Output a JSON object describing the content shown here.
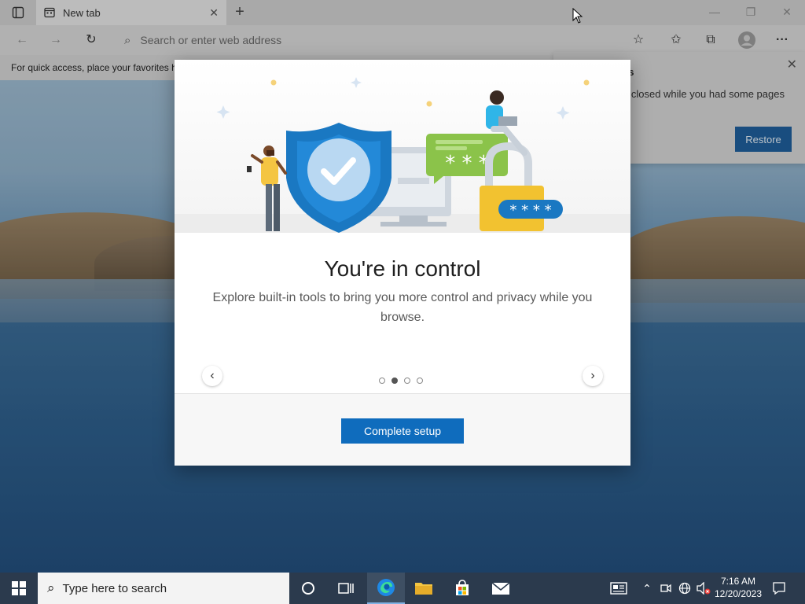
{
  "browser": {
    "tab_title": "New tab",
    "address_placeholder": "Search or enter web address",
    "favorites_bar_text": "For quick access, place your favorites h"
  },
  "restore_notification": {
    "title_fragment": "es",
    "body_fragment": "e closed while you had some pages",
    "restore_label": "Restore"
  },
  "modal": {
    "heading": "You're in control",
    "description": "Explore built-in tools to bring you more control and privacy while you browse.",
    "prev_arrow": "‹",
    "next_arrow": "›",
    "page_count": 4,
    "active_page": 2,
    "complete_label": "Complete setup",
    "illustration": {
      "password_text_green": "* * *",
      "password_text_blue": "* * * *"
    }
  },
  "taskbar": {
    "search_placeholder": "Type here to search",
    "time": "7:16 AM",
    "date": "12/20/2023"
  },
  "colors": {
    "accent": "#0f6cbd",
    "shield": "#1a78c2",
    "green_bubble": "#8bc34a",
    "lock": "#f2c230",
    "taskbar": "#2b3a4d"
  }
}
